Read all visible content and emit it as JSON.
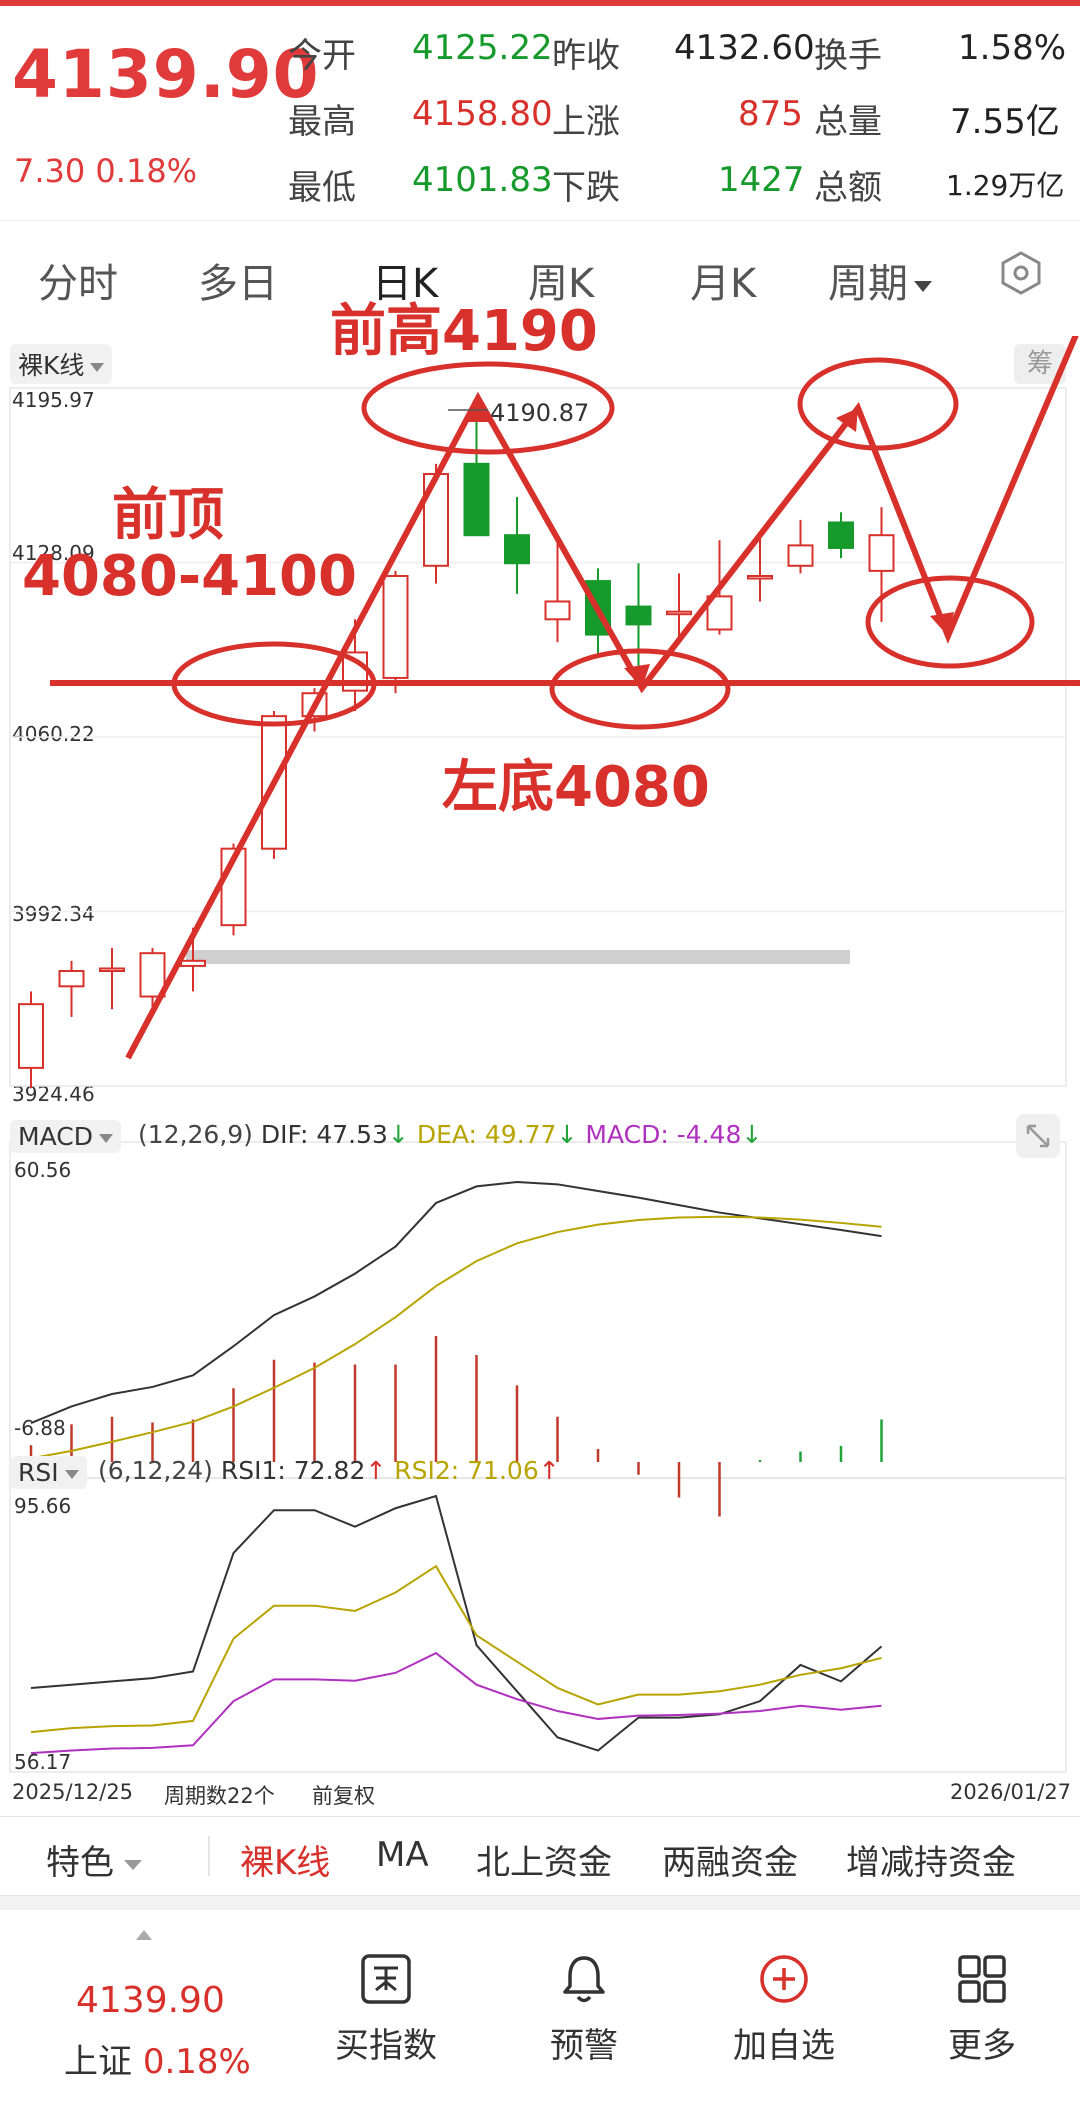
{
  "quote": {
    "price": "4139.90",
    "change": "7.30 0.18%",
    "stats": [
      {
        "label": "今开",
        "value": "4125.22",
        "color": "green"
      },
      {
        "label": "昨收",
        "value": "4132.60",
        "color": "black"
      },
      {
        "label": "换手",
        "value": "1.58%",
        "color": "black"
      },
      {
        "label": "最高",
        "value": "4158.80",
        "color": "red"
      },
      {
        "label": "上涨",
        "value": "875",
        "color": "red"
      },
      {
        "label": "总量",
        "value": "7.55亿",
        "color": "black"
      },
      {
        "label": "最低",
        "value": "4101.83",
        "color": "green"
      },
      {
        "label": "下跌",
        "value": "1427",
        "color": "green"
      },
      {
        "label": "总额",
        "value": "1.29万亿",
        "color": "black"
      }
    ]
  },
  "tabs": [
    "分时",
    "多日",
    "日K",
    "周K",
    "月K"
  ],
  "tab_period": "周期",
  "kline": {
    "mode_label": "裸K线",
    "right_chip": "筹",
    "y_labels": [
      "4195.97",
      "4128.09",
      "4060.22",
      "3992.34",
      "3924.46"
    ],
    "high_label": "4190.87",
    "date_start": "2025/12/25",
    "period_count": "周期数22个",
    "adjust": "前复权",
    "date_end": "2026/01/27"
  },
  "chart_data": {
    "type": "candlestick",
    "candles": [
      {
        "o": 3930,
        "h": 3960,
        "l": 3922,
        "c": 3955
      },
      {
        "o": 3962,
        "h": 3972,
        "l": 3950,
        "c": 3968
      },
      {
        "o": 3968,
        "h": 3977,
        "l": 3953,
        "c": 3969
      },
      {
        "o": 3958,
        "h": 3977,
        "l": 3953,
        "c": 3975
      },
      {
        "o": 3970,
        "h": 3985,
        "l": 3960,
        "c": 3972
      },
      {
        "o": 3986,
        "h": 4018,
        "l": 3982,
        "c": 4016
      },
      {
        "o": 4016,
        "h": 4070,
        "l": 4012,
        "c": 4068
      },
      {
        "o": 4068,
        "h": 4079,
        "l": 4062,
        "c": 4077
      },
      {
        "o": 4078,
        "h": 4106,
        "l": 4070,
        "c": 4093
      },
      {
        "o": 4083,
        "h": 4125,
        "l": 4077,
        "c": 4123
      },
      {
        "o": 4127,
        "h": 4167,
        "l": 4120,
        "c": 4163
      },
      {
        "o": 4167,
        "h": 4191,
        "l": 4142,
        "c": 4139
      },
      {
        "o": 4139,
        "h": 4154,
        "l": 4116,
        "c": 4128
      },
      {
        "o": 4106,
        "h": 4136,
        "l": 4097,
        "c": 4113
      },
      {
        "o": 4121,
        "h": 4126,
        "l": 4092,
        "c": 4100
      },
      {
        "o": 4111,
        "h": 4128,
        "l": 4084,
        "c": 4104
      },
      {
        "o": 4108,
        "h": 4124,
        "l": 4099,
        "c": 4109
      },
      {
        "o": 4102,
        "h": 4137,
        "l": 4100,
        "c": 4115
      },
      {
        "o": 4122,
        "h": 4138,
        "l": 4113,
        "c": 4123
      },
      {
        "o": 4127,
        "h": 4145,
        "l": 4124,
        "c": 4135
      },
      {
        "o": 4144,
        "h": 4148,
        "l": 4130,
        "c": 4134
      },
      {
        "o": 4125,
        "h": 4150,
        "l": 4105,
        "c": 4139
      }
    ],
    "ylim": [
      3924.46,
      4195.97
    ],
    "macd": {
      "label": "MACD",
      "params": "(12,26,9)",
      "dif_label": "DIF: 47.53",
      "dea_label": "DEA: 49.77",
      "macd_label": "MACD: -4.48",
      "ylim": [
        -6.88,
        60.56
      ],
      "dif": [
        2.5,
        6.5,
        9.5,
        11.2,
        14.0,
        21.0,
        28.5,
        33.0,
        38.5,
        45.0,
        55.5,
        59.5,
        60.56,
        60.0,
        58.4,
        56.8,
        55.0,
        53.2,
        51.8,
        50.4,
        49.0,
        47.53
      ],
      "dea": [
        -6.0,
        -4.2,
        -2.0,
        0.3,
        2.8,
        6.5,
        11.0,
        15.8,
        21.5,
        28.0,
        35.5,
        41.5,
        45.8,
        48.5,
        50.3,
        51.4,
        52.0,
        52.2,
        52.0,
        51.5,
        50.7,
        49.77
      ],
      "hist": [
        8.5,
        10.7,
        11.5,
        10.9,
        11.2,
        14.5,
        17.5,
        17.2,
        17.0,
        17.0,
        20.0,
        18.0,
        14.8,
        11.5,
        8.1,
        5.4,
        3.0,
        1.0,
        -0.2,
        -1.1,
        -1.7,
        -4.48
      ]
    },
    "rsi": {
      "label": "RSI",
      "params": "(6,12,24)",
      "rsi1_label": "RSI1: 72.82",
      "rsi2_label": "RSI2: 71.06",
      "ylim": [
        56.17,
        95.66
      ],
      "rsi1": [
        66.5,
        67.0,
        67.5,
        68.0,
        69.0,
        87.0,
        93.5,
        93.5,
        91.0,
        93.8,
        95.66,
        73.0,
        66.0,
        59.0,
        57.0,
        62.0,
        62.0,
        62.5,
        64.5,
        70.0,
        67.5,
        72.82
      ],
      "rsi2": [
        59.8,
        60.4,
        60.7,
        60.8,
        61.5,
        74.0,
        79.0,
        79.0,
        78.2,
        81.0,
        85.0,
        74.5,
        70.5,
        66.5,
        64.0,
        65.5,
        65.5,
        66.0,
        67.0,
        68.5,
        69.5,
        71.06
      ],
      "rsi3": [
        56.6,
        57.0,
        57.3,
        57.4,
        57.8,
        64.5,
        67.8,
        67.8,
        67.6,
        68.8,
        71.8,
        67.0,
        64.8,
        63.0,
        61.8,
        62.3,
        62.4,
        62.6,
        63.0,
        63.8,
        63.2,
        63.8
      ]
    }
  },
  "annotations": {
    "prev_high": "前高4190",
    "prev_top": "前顶",
    "prev_top_range": "4080-4100",
    "left_bottom": "左底4080"
  },
  "subtabs": [
    "特色",
    "裸K线",
    "MA",
    "北上资金",
    "两融资金",
    "增减持资金"
  ],
  "bottom": {
    "price": "4139.90",
    "index_name": "上证",
    "index_change": "0.18%",
    "items": [
      {
        "label": "买指数",
        "icon": "buy-icon"
      },
      {
        "label": "预警",
        "icon": "bell-icon"
      },
      {
        "label": "加自选",
        "icon": "add-watch-icon"
      },
      {
        "label": "更多",
        "icon": "grid-icon"
      }
    ]
  },
  "colors": {
    "up": "#d8302b",
    "down": "#159a2b",
    "accent": "#e03a3a"
  }
}
